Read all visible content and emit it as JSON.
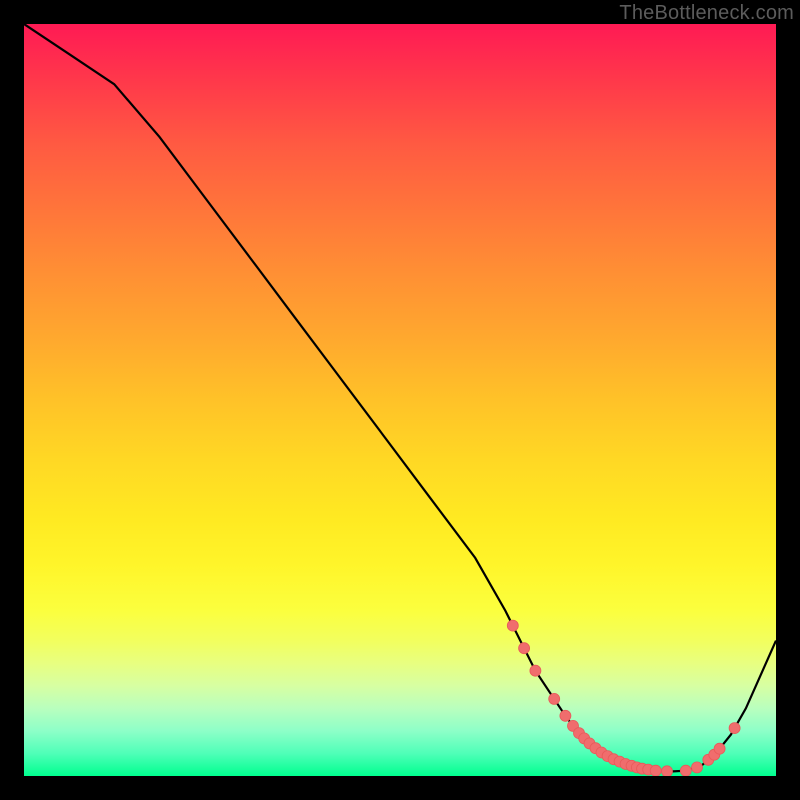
{
  "watermark": "TheBottleneck.com",
  "colors": {
    "curve_stroke": "#000000",
    "marker_fill": "#f06d6d",
    "marker_stroke": "#e85a5a",
    "gradient_top": "#ff1a54",
    "gradient_bottom": "#00ff8f",
    "page_background": "#000000"
  },
  "chart_data": {
    "type": "line",
    "title": "",
    "xlabel": "",
    "ylabel": "",
    "xlim": [
      0,
      100
    ],
    "ylim": [
      0,
      100
    ],
    "grid": false,
    "legend": false,
    "series": [
      {
        "name": "curve",
        "x": [
          0,
          6,
          12,
          18,
          24,
          30,
          36,
          42,
          48,
          54,
          60,
          64,
          66,
          68,
          70,
          72,
          73.5,
          75,
          76.5,
          78,
          80,
          82,
          84,
          86,
          88,
          90,
          92,
          94,
          96,
          100
        ],
        "y": [
          100,
          96,
          92,
          85,
          77,
          69,
          61,
          53,
          45,
          37,
          29,
          22,
          18,
          14,
          11,
          8,
          6,
          4.5,
          3.3,
          2.4,
          1.6,
          1.0,
          0.7,
          0.6,
          0.7,
          1.3,
          3.0,
          5.5,
          9.0,
          18
        ]
      }
    ],
    "marker_x": [
      65,
      66.5,
      68,
      70.5,
      72,
      73,
      73.8,
      74.5,
      75.2,
      76,
      76.8,
      77.6,
      78.4,
      79.2,
      80,
      80.8,
      81.5,
      82.2,
      83,
      84,
      85.5,
      88,
      89.5,
      91,
      91.8,
      92.5,
      94.5
    ]
  }
}
